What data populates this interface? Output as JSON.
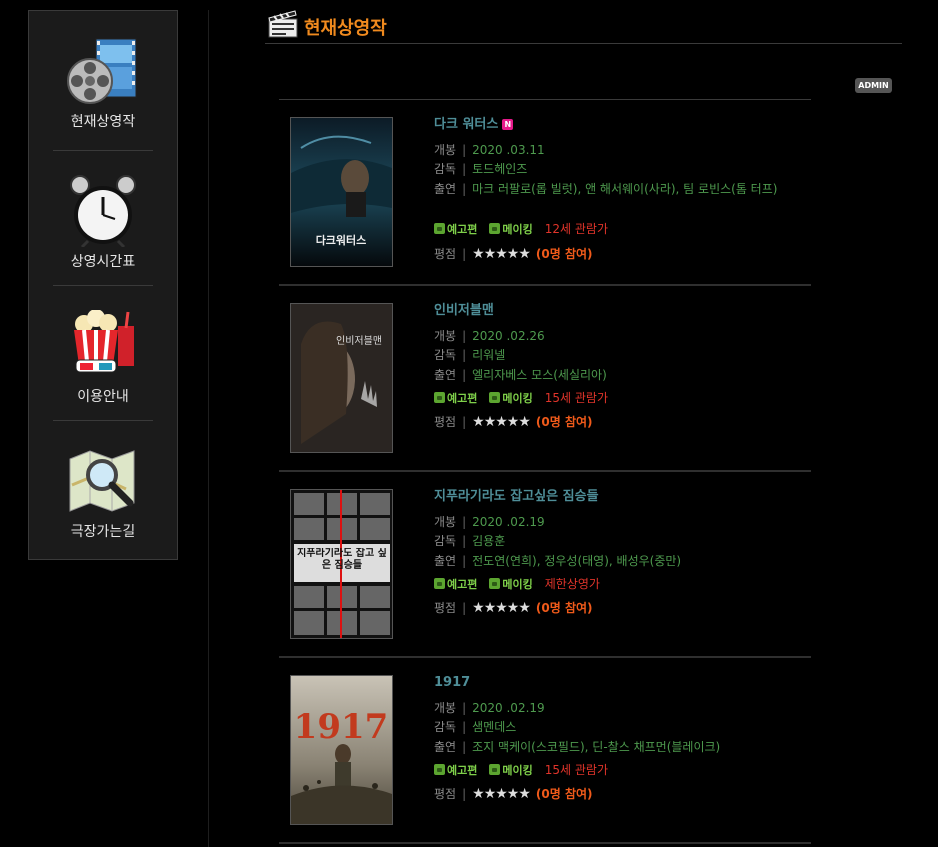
{
  "sidebar": {
    "items": [
      {
        "label": "현재상영작",
        "icon": "film-reel-icon"
      },
      {
        "label": "상영시간표",
        "icon": "alarm-clock-icon"
      },
      {
        "label": "이용안내",
        "icon": "popcorn-icon"
      },
      {
        "label": "극장가는길",
        "icon": "map-search-icon"
      }
    ]
  },
  "header": {
    "title": "현재상영작",
    "icon": "clapperboard-icon",
    "admin_label": "ADMIN"
  },
  "labels": {
    "open": "개봉",
    "director": "감독",
    "cast": "출연",
    "rating": "평점",
    "sep": "|",
    "trailer": "예고편",
    "making": "메이킹",
    "stars": "★★★★★"
  },
  "movies": [
    {
      "title": "다크 워터스",
      "new": true,
      "new_label": "N",
      "open": "2020 .03.11",
      "director": "토드헤인즈",
      "cast": "마크 러팔로(롭 빌럿), 앤 해서웨이(사라), 팀 로빈스(톰 터프)",
      "age": "12세 관람가",
      "participants": "(0명 참여)",
      "poster_text": "다크워터스"
    },
    {
      "title": "인비저블맨",
      "new": false,
      "open": "2020 .02.26",
      "director": "리워넬",
      "cast": "엘리자베스 모스(세실리아)",
      "age": "15세 관람가",
      "participants": "(0명 참여)",
      "poster_text": "인비저블맨"
    },
    {
      "title": "지푸라기라도 잡고싶은 짐승들",
      "new": false,
      "open": "2020 .02.19",
      "director": "김용훈",
      "cast": "전도연(연희), 정우성(태영), 배성우(중만)",
      "age": "제한상영가",
      "participants": "(0명 참여)",
      "poster_text": "지푸라기라도 잡고 싶은 짐승들"
    },
    {
      "title": "1917",
      "new": false,
      "open": "2020 .02.19",
      "director": "샘멘데스",
      "cast": "조지 맥케이(스코필드), 딘-찰스 채프먼(블레이크)",
      "age": "15세 관람가",
      "participants": "(0명 참여)",
      "poster_text": "1917"
    }
  ]
}
